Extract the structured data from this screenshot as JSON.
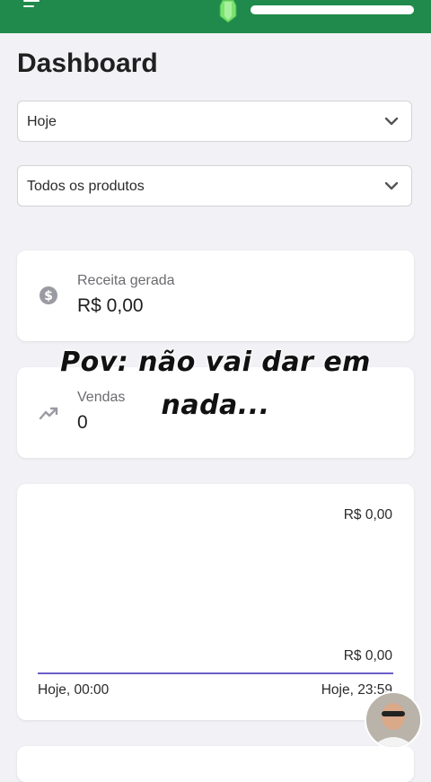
{
  "page": {
    "title": "Dashboard"
  },
  "filters": {
    "period": "Hoje",
    "product": "Todos os produtos"
  },
  "stats": {
    "revenue": {
      "label": "Receita gerada",
      "value": "R$ 0,00",
      "icon": "dollar-circle-icon"
    },
    "sales": {
      "label": "Vendas",
      "value": "0",
      "icon": "trending-up-icon"
    }
  },
  "chart": {
    "top_value": "R$ 0,00",
    "bottom_value": "R$ 0,00",
    "x_start": "Hoje, 00:00",
    "x_end": "Hoje, 23:59",
    "line_color": "#6b5fc7"
  },
  "overlay": {
    "line1": "Pov: não vai dar em",
    "line2": "nada..."
  },
  "colors": {
    "topbar": "#1f8a4c",
    "background": "#f2f1f5"
  }
}
